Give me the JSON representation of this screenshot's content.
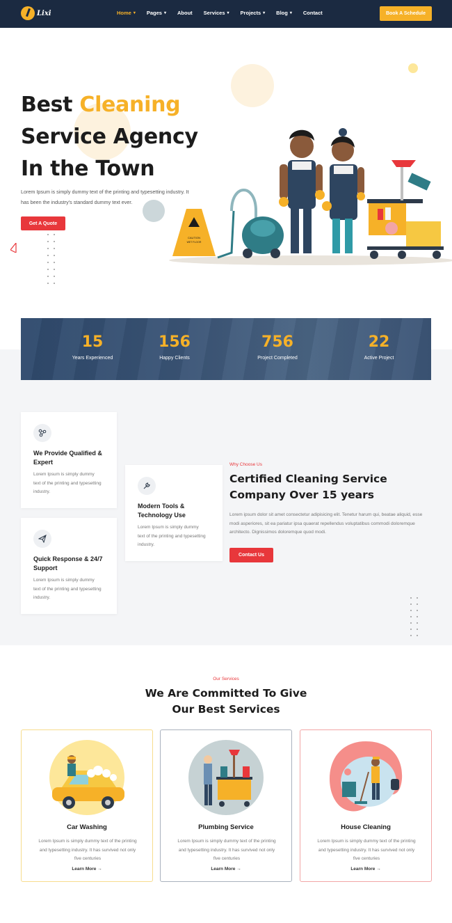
{
  "nav": {
    "logo_text": "Lixi",
    "menu": [
      {
        "label": "Home",
        "caret": true,
        "active": true
      },
      {
        "label": "Pages",
        "caret": true
      },
      {
        "label": "About",
        "caret": false
      },
      {
        "label": "Services",
        "caret": true
      },
      {
        "label": "Projects",
        "caret": true
      },
      {
        "label": "Blog",
        "caret": true
      },
      {
        "label": "Contact",
        "caret": false
      }
    ],
    "cta": "Book A Schedule"
  },
  "hero": {
    "title_1": "Best ",
    "title_highlight": "Cleaning",
    "title_2": "Service Agency",
    "title_3": "In the Town",
    "text": "Lorem Ipsum is simply dummy text of the printing and typesetting industry. It has been the industry's standard dummy text ever.",
    "button": "Get A Quote",
    "sign_line1": "CAUTION",
    "sign_line2": "WET FLOOR"
  },
  "stats": [
    {
      "number": "15",
      "label": "Years Experienced"
    },
    {
      "number": "156",
      "label": "Happy Clients"
    },
    {
      "number": "756",
      "label": "Project Completed"
    },
    {
      "number": "22",
      "label": "Active Project"
    }
  ],
  "why": {
    "cards": [
      {
        "title": "We Provide Qualified & Expert",
        "text": "Lorem Ipsum is simply dummy text of the printing and typesetting industry.",
        "icon": "network-icon"
      },
      {
        "title": "Modern Tools & Technology Use",
        "text": "Lorem Ipsum is simply dummy text of the printing and typesetting industry.",
        "icon": "wrench-icon"
      },
      {
        "title": "Quick Response & 24/7 Support",
        "text": "Lorem Ipsum is simply dummy text of the printing and typesetting industry.",
        "icon": "paper-plane-icon"
      }
    ],
    "subtitle": "Why Choose Us",
    "title": "Certified Cleaning Service Company Over 15 years",
    "text": "Lorem ipsum dolor sit amet consectetur adipisicing elit. Tenetur harum qui, beatae aliquid, esse modi asperiores, sit ea pariatur ipsa quaerat repellendus voluptatibus commodi doloremque architecto. Dignissimos doloremque quod modi.",
    "button": "Contact Us"
  },
  "services": {
    "subtitle": "Our Services",
    "title": "We Are Committed To Give Our Best Services",
    "items": [
      {
        "name": "Car Washing",
        "text": "Lorem Ipsum is simply dummy text of the printing and typesetting industry. It has survived not only five centuries",
        "link": "Learn More →",
        "border": "#f7dc8c",
        "blob": "#fde79a"
      },
      {
        "name": "Plumbing Service",
        "text": "Lorem Ipsum is simply dummy text of the printing and typesetting industry. It has survived not only five centuries",
        "link": "Learn More →",
        "border": "#a9b1bd",
        "blob": "#c6d2d4"
      },
      {
        "name": "House Cleaning",
        "text": "Lorem Ipsum is simply dummy text of the printing and typesetting industry. It has survived not only five centuries",
        "link": "Learn More →",
        "border": "#f2a5a5",
        "blob": "#f58e8a"
      }
    ]
  },
  "colors": {
    "accent": "#f6b128",
    "red": "#e8373b",
    "navy": "#1b2a41"
  }
}
